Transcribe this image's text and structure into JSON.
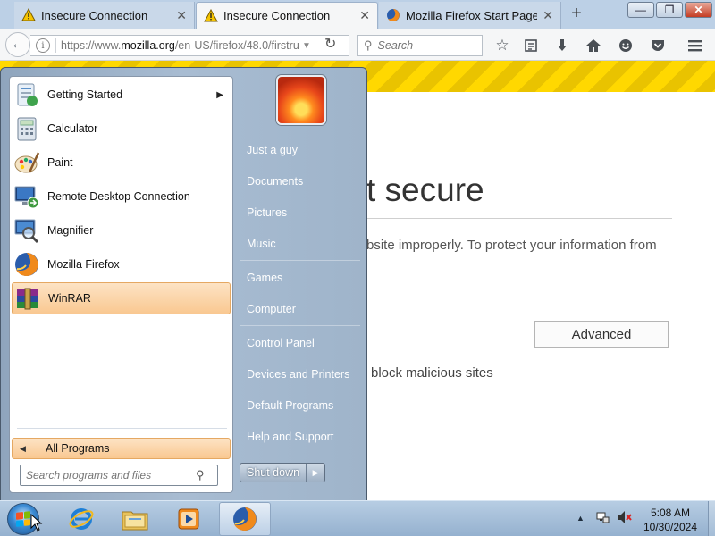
{
  "browser": {
    "tabs": [
      {
        "label": "Insecure Connection",
        "icon": "warning-triangle-icon",
        "active": false
      },
      {
        "label": "Insecure Connection",
        "icon": "warning-triangle-icon",
        "active": true
      },
      {
        "label": "Mozilla Firefox Start Page",
        "icon": "firefox-icon",
        "active": false
      }
    ],
    "close_glyph": "✕",
    "new_tab_glyph": "+",
    "window_controls": {
      "minimize": "—",
      "maximize": "❐",
      "close": "✕"
    },
    "url_prefix": "https://www.",
    "url_domain": "mozilla.org",
    "url_suffix": "/en-US/firefox/48.0/firstru",
    "url_drop_glyph": "▼",
    "reload_glyph": "↻",
    "back_glyph": "←",
    "search_placeholder": "Search",
    "toolbar_icons": [
      "bookmark-star-icon",
      "reading-list-icon",
      "download-icon",
      "home-icon",
      "hello-icon",
      "pocket-icon",
      "menu-icon"
    ]
  },
  "page": {
    "error_title": "t secure",
    "error_desc": "bsite improperly. To protect your information from",
    "advanced_label": "Advanced",
    "block_text": "block malicious sites"
  },
  "start_menu": {
    "programs": [
      {
        "label": "Getting Started",
        "icon": "getting-started-icon",
        "has_submenu": true
      },
      {
        "label": "Calculator",
        "icon": "calculator-icon"
      },
      {
        "label": "Paint",
        "icon": "paint-icon"
      },
      {
        "label": "Remote Desktop Connection",
        "icon": "remote-desktop-icon"
      },
      {
        "label": "Magnifier",
        "icon": "magnifier-icon"
      },
      {
        "label": "Mozilla Firefox",
        "icon": "firefox-icon"
      },
      {
        "label": "WinRAR",
        "icon": "winrar-icon",
        "highlighted": true
      }
    ],
    "all_programs_label": "All Programs",
    "search_placeholder": "Search programs and files",
    "right_links": [
      "Just a guy",
      "Documents",
      "Pictures",
      "Music",
      "Games",
      "Computer",
      "Control Panel",
      "Devices and Printers",
      "Default Programs",
      "Help and Support"
    ],
    "shutdown_label": "Shut down",
    "submenu_glyph": "▶"
  },
  "taskbar": {
    "apps": [
      "internet-explorer-icon",
      "windows-explorer-icon",
      "media-player-icon",
      "firefox-icon"
    ],
    "tray_expand_glyph": "▲",
    "time": "5:08 AM",
    "date": "10/30/2024"
  },
  "colors": {
    "warning_stripe": "#ffd800",
    "start_menu_highlight": "#f9c891",
    "taskbar": "#95b1cf"
  }
}
